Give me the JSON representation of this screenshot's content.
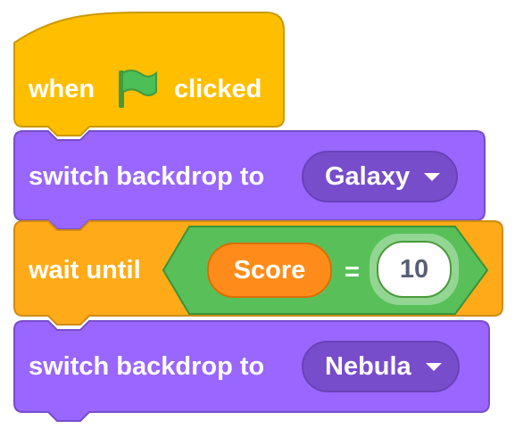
{
  "colors": {
    "events": "#ffbf00",
    "looks": "#9966ff",
    "control": "#ffab19",
    "operators": "#59c059",
    "variables": "#ff8c1a",
    "flag": "#4cbf56"
  },
  "script": {
    "hat_block": {
      "prefix": "when",
      "icon": "green-flag-icon",
      "suffix": "clicked"
    },
    "block_1": {
      "label": "switch backdrop to",
      "dropdown_value": "Galaxy"
    },
    "block_2": {
      "label": "wait until",
      "condition": {
        "left_reporter": "Score",
        "operator": "=",
        "right_value": "10"
      }
    },
    "block_3": {
      "label": "switch backdrop to",
      "dropdown_value": "Nebula"
    }
  }
}
